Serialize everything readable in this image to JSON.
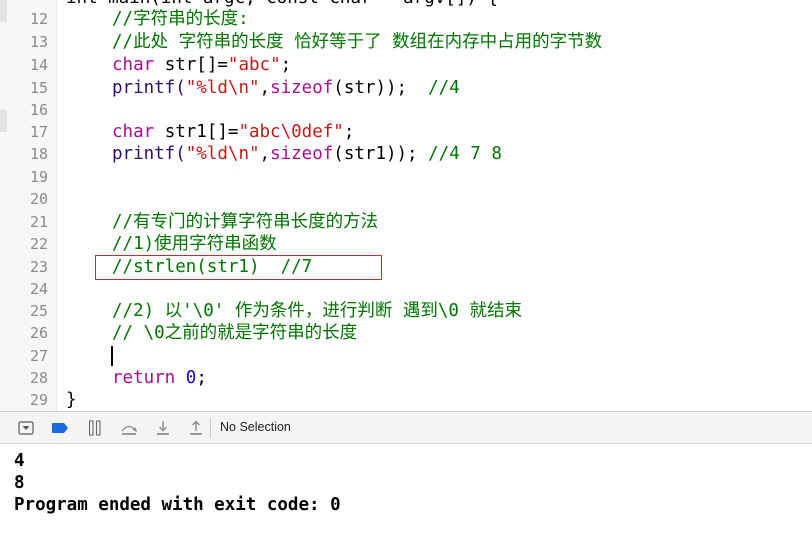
{
  "editor": {
    "partial_top_text": "int main(int argc, const char * argv[]) {",
    "lines": [
      {
        "n": "12",
        "t": "//字符串的长度:"
      },
      {
        "n": "13",
        "t": "//此处 字符串的长度 恰好等于了 数组在内存中占用的字节数"
      },
      {
        "n": "14",
        "a": "char",
        "b": " str[]=",
        "c": "\"abc\"",
        "d": ";"
      },
      {
        "n": "15",
        "a": "printf(",
        "b": "\"%ld\\n\"",
        "c": ",",
        "d": "sizeof",
        "e": "(str));  ",
        "f": "//4"
      },
      {
        "n": "16"
      },
      {
        "n": "17",
        "a": "char",
        "b": " str1[]=",
        "c": "\"abc\\0def\"",
        "d": ";"
      },
      {
        "n": "18",
        "a": "printf(",
        "b": "\"%ld\\n\"",
        "c": ",",
        "d": "sizeof",
        "e": "(str1)); ",
        "f": "//4 7 8"
      },
      {
        "n": "19"
      },
      {
        "n": "20"
      },
      {
        "n": "21",
        "t": "//有专门的计算字符串长度的方法"
      },
      {
        "n": "22",
        "t": "//1)使用字符串函数"
      },
      {
        "n": "23",
        "t": "//strlen(str1)  //7"
      },
      {
        "n": "24"
      },
      {
        "n": "25",
        "t": "//2) 以'\\0' 作为条件，进行判断 遇到\\0 就结束"
      },
      {
        "n": "26",
        "t": "// \\0之前的就是字符串的长度"
      },
      {
        "n": "27"
      },
      {
        "n": "28",
        "a": "return",
        "b": " ",
        "c": "0",
        "d": ";"
      },
      {
        "n": "29",
        "t": "}"
      }
    ]
  },
  "debug_bar": {
    "selection_label": "No Selection",
    "icons": [
      "hide-debug-area-icon",
      "breakpoint-toggle-icon",
      "pause-icon",
      "step-over-icon",
      "step-into-icon",
      "step-out-icon"
    ],
    "accent_color": "#1a6ae0"
  },
  "console": {
    "output_lines": [
      "4",
      "8",
      "Program ended with exit code: 0"
    ]
  }
}
